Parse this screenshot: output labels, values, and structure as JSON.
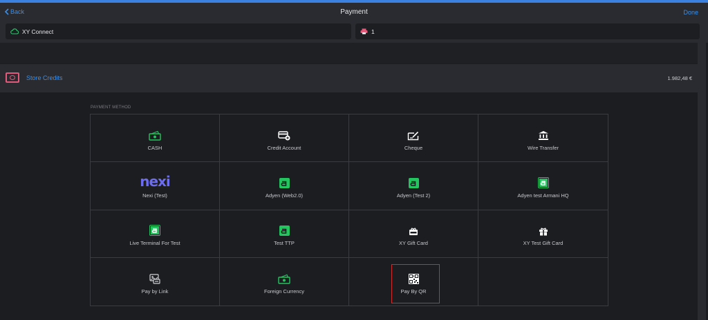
{
  "header": {
    "back_label": "Back",
    "title": "Payment",
    "done_label": "Done"
  },
  "connection": {
    "label": "XY Connect",
    "icon": "cloud-icon",
    "color": "#2ecc71"
  },
  "printer": {
    "label": "1",
    "icon": "printer-icon",
    "color": "#e35b7a"
  },
  "store_credits": {
    "label": "Store Credits",
    "amount": "1.982,48 €",
    "icon": "wallet-icon"
  },
  "payment_method_label": "PAYMENT METHOD",
  "methods": [
    {
      "label": "CASH",
      "icon": "cash-icon"
    },
    {
      "label": "Credit Account",
      "icon": "credit-account-icon"
    },
    {
      "label": "Cheque",
      "icon": "cheque-icon"
    },
    {
      "label": "Wire Transfer",
      "icon": "bank-icon"
    },
    {
      "label": "Nexi (Test)",
      "icon": "nexi-logo",
      "logo_text": "nexi"
    },
    {
      "label": "Adyen (Web2.0)",
      "icon": "adyen-icon"
    },
    {
      "label": "Adyen (Test 2)",
      "icon": "adyen-icon"
    },
    {
      "label": "Adyen test Armani HQ",
      "icon": "adyen-icon"
    },
    {
      "label": "Live Terminal For Test",
      "icon": "adyen-icon"
    },
    {
      "label": "Test TTP",
      "icon": "adyen-icon"
    },
    {
      "label": "XY Gift Card",
      "icon": "gift-card-icon"
    },
    {
      "label": "XY Test Gift Card",
      "icon": "gift-icon"
    },
    {
      "label": "Pay by Link",
      "icon": "pay-link-icon"
    },
    {
      "label": "Foreign Currency",
      "icon": "foreign-currency-icon"
    },
    {
      "label": "Pay By QR",
      "icon": "qr-code-icon"
    }
  ],
  "colors": {
    "accent": "#3b8fe8",
    "green": "#22c55e",
    "highlight": "#d12b2b"
  }
}
